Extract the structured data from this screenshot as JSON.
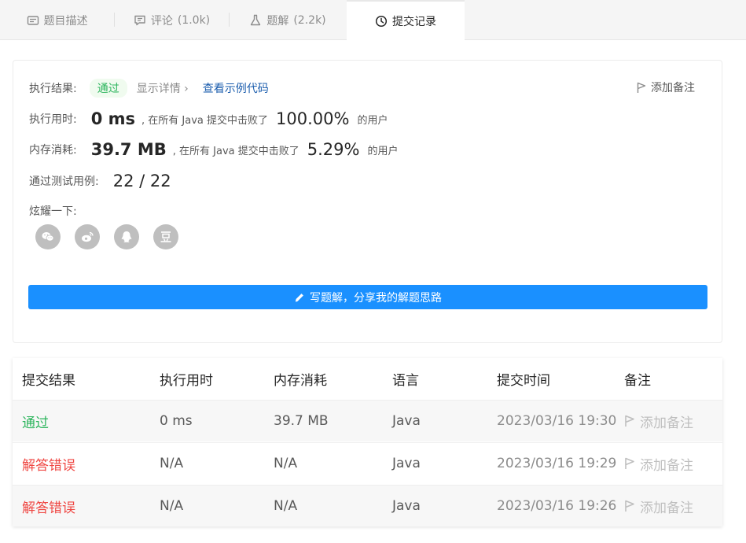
{
  "tabs": [
    {
      "label": "题目描述",
      "count": ""
    },
    {
      "label": "评论",
      "count": "(1.0k)"
    },
    {
      "label": "题解",
      "count": "(2.2k)"
    },
    {
      "label": "提交记录",
      "count": ""
    }
  ],
  "result": {
    "label": "执行结果:",
    "status": "通过",
    "detail": "显示详情 ›",
    "sample_link": "查看示例代码",
    "add_note": "添加备注",
    "time_label": "执行用时:",
    "time_value": "0 ms",
    "time_mid": ", 在所有 Java 提交中击败了",
    "time_pct": "100.00%",
    "time_tail": "的用户",
    "mem_label": "内存消耗:",
    "mem_value": "39.7 MB",
    "mem_mid": ", 在所有 Java 提交中击败了",
    "mem_pct": "5.29%",
    "mem_tail": "的用户",
    "tests_label": "通过测试用例:",
    "tests_value": "22 / 22",
    "share_label": "炫耀一下:",
    "write_button": "写题解，分享我的解题思路"
  },
  "table": {
    "headers": [
      "提交结果",
      "执行用时",
      "内存消耗",
      "语言",
      "提交时间",
      "备注"
    ],
    "rows": [
      {
        "status": "通过",
        "time": "0 ms",
        "memory": "39.7 MB",
        "lang": "Java",
        "submitted": "2023/03/16 19:30",
        "note": "添加备注"
      },
      {
        "status": "解答错误",
        "time": "N/A",
        "memory": "N/A",
        "lang": "Java",
        "submitted": "2023/03/16 19:29",
        "note": "添加备注"
      },
      {
        "status": "解答错误",
        "time": "N/A",
        "memory": "N/A",
        "lang": "Java",
        "submitted": "2023/03/16 19:26",
        "note": "添加备注"
      }
    ]
  },
  "colors": {
    "accent": "#1a90ff",
    "success": "#2db55d",
    "error": "#ef4743"
  }
}
